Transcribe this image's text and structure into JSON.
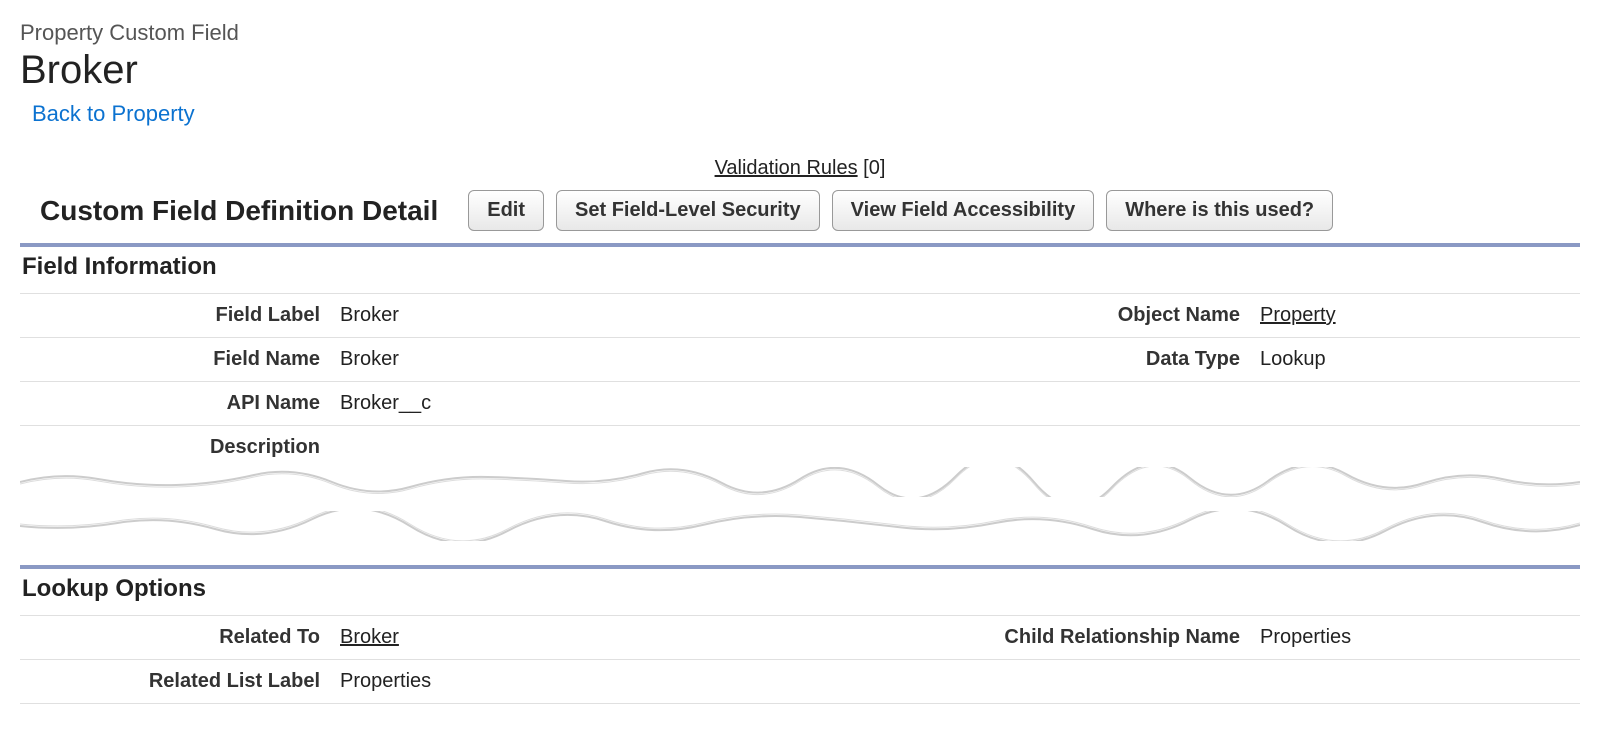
{
  "header": {
    "subtitle": "Property Custom Field",
    "title": "Broker",
    "back_link": "Back to Property"
  },
  "anchor": {
    "label": "Validation Rules",
    "count": "[0]"
  },
  "detail": {
    "title": "Custom Field Definition Detail",
    "buttons": {
      "edit": "Edit",
      "set_fls": "Set Field-Level Security",
      "view_accessibility": "View Field Accessibility",
      "where_used": "Where is this used?"
    }
  },
  "field_info": {
    "section_title": "Field Information",
    "rows": {
      "field_label": {
        "label": "Field Label",
        "value": "Broker"
      },
      "object_name": {
        "label": "Object Name",
        "value": "Property"
      },
      "field_name": {
        "label": "Field Name",
        "value": "Broker"
      },
      "data_type": {
        "label": "Data Type",
        "value": "Lookup"
      },
      "api_name": {
        "label": "API Name",
        "value": "Broker__c"
      },
      "description": {
        "label": "Description",
        "value": ""
      }
    }
  },
  "lookup_options": {
    "section_title": "Lookup Options",
    "rows": {
      "related_to": {
        "label": "Related To",
        "value": "Broker"
      },
      "child_rel_name": {
        "label": "Child Relationship Name",
        "value": "Properties"
      },
      "related_list_label": {
        "label": "Related List Label",
        "value": "Properties"
      }
    }
  }
}
